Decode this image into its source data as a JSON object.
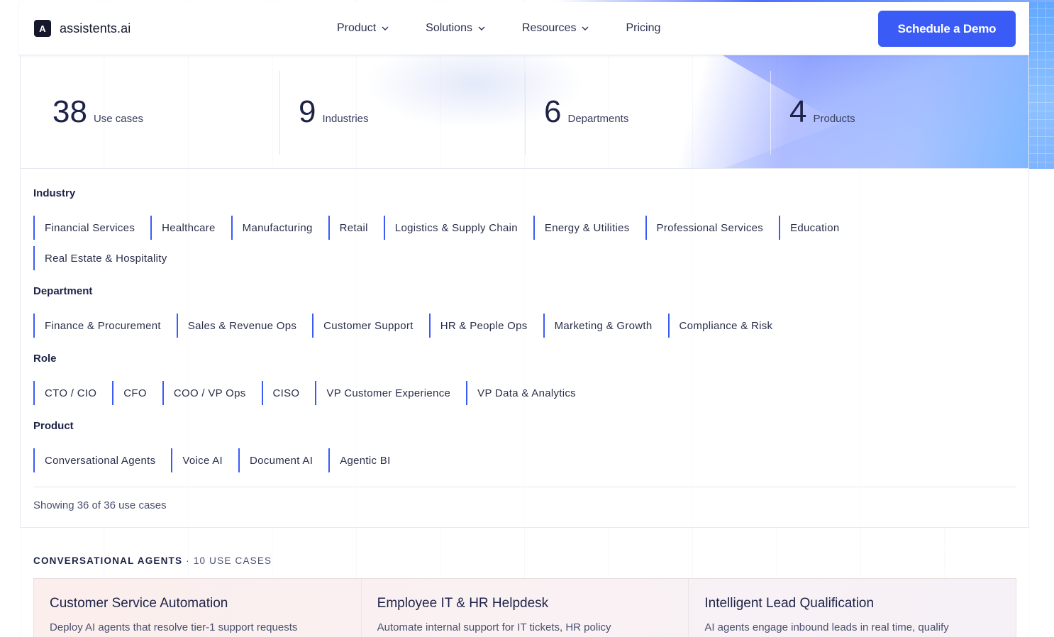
{
  "brand": {
    "logo_letter": "A",
    "name": "assistents.ai",
    "accent": "#3b5bf6"
  },
  "nav": {
    "links": [
      {
        "label": "Product",
        "has_dropdown": true
      },
      {
        "label": "Solutions",
        "has_dropdown": true
      },
      {
        "label": "Resources",
        "has_dropdown": true
      },
      {
        "label": "Pricing",
        "has_dropdown": false
      }
    ],
    "cta": "Schedule a Demo"
  },
  "stats": [
    {
      "value": "38",
      "label": "Use cases"
    },
    {
      "value": "9",
      "label": "Industries"
    },
    {
      "value": "6",
      "label": "Departments"
    },
    {
      "value": "4",
      "label": "Products"
    }
  ],
  "filters": {
    "industry": {
      "label": "Industry",
      "options": [
        "Financial Services",
        "Healthcare",
        "Manufacturing",
        "Retail",
        "Logistics & Supply Chain",
        "Energy & Utilities",
        "Professional Services",
        "Education",
        "Real Estate & Hospitality"
      ]
    },
    "department": {
      "label": "Department",
      "options": [
        "Finance & Procurement",
        "Sales & Revenue Ops",
        "Customer Support",
        "HR & People Ops",
        "Marketing & Growth",
        "Compliance & Risk"
      ]
    },
    "role": {
      "label": "Role",
      "options": [
        "CTO / CIO",
        "CFO",
        "COO / VP Ops",
        "CISO",
        "VP Customer Experience",
        "VP Data & Analytics"
      ]
    },
    "product": {
      "label": "Product",
      "options": [
        "Conversational Agents",
        "Voice AI",
        "Document AI",
        "Agentic BI"
      ]
    },
    "showing": "Showing 36 of 36 use cases"
  },
  "section": {
    "title": "CONVERSATIONAL AGENTS",
    "count": " · 10 USE CASES",
    "cards": [
      {
        "title": "Customer Service Automation",
        "desc": "Deploy AI agents that resolve tier-1 support requests"
      },
      {
        "title": "Employee IT & HR Helpdesk",
        "desc": "Automate internal support for IT tickets, HR policy"
      },
      {
        "title": "Intelligent Lead Qualification",
        "desc": "AI agents engage inbound leads in real time, qualify"
      }
    ]
  }
}
